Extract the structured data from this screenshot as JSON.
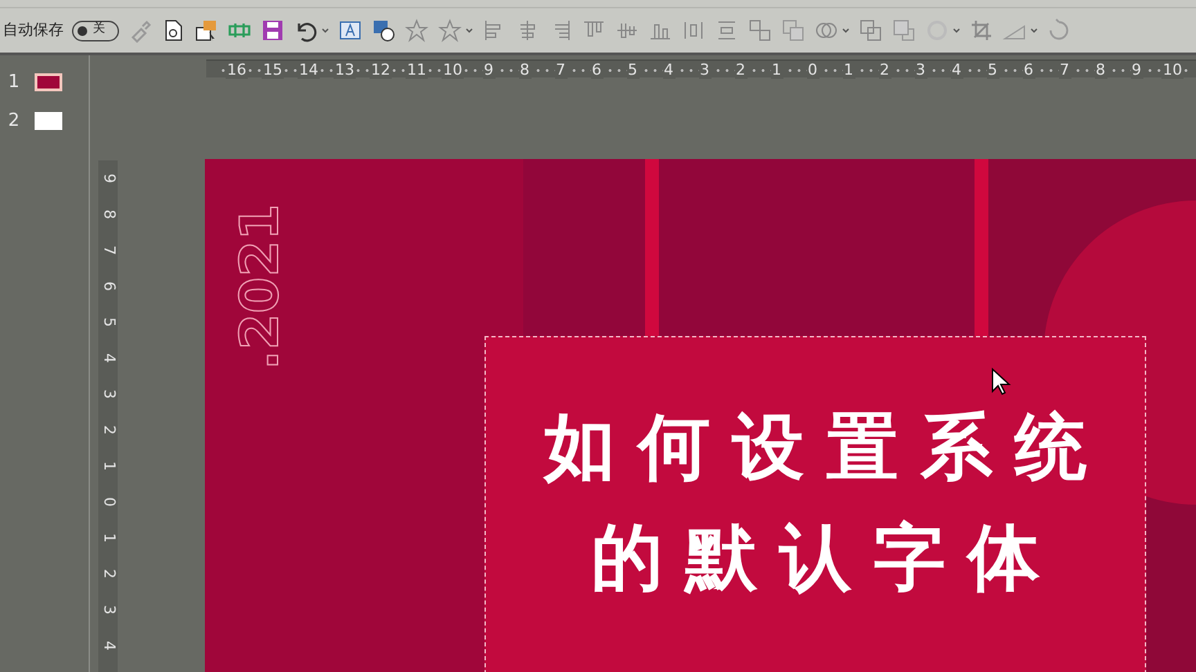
{
  "toolbar": {
    "autosave_label": "自动保存",
    "autosave_toggle": {
      "on": false,
      "label": "关"
    }
  },
  "slides": [
    {
      "number": "1",
      "kind": "title",
      "selected": true
    },
    {
      "number": "2",
      "kind": "blank",
      "selected": false
    }
  ],
  "horizontal_ruler": {
    "labels": [
      "16",
      "15",
      "14",
      "13",
      "12",
      "11",
      "10",
      "9",
      "8",
      "7",
      "6",
      "5",
      "4",
      "3",
      "2",
      "1",
      "0",
      "1",
      "2",
      "3",
      "4",
      "5",
      "6",
      "7",
      "8",
      "9",
      "10"
    ]
  },
  "vertical_ruler": {
    "labels": [
      "9",
      "8",
      "7",
      "6",
      "5",
      "4",
      "3",
      "2",
      "1",
      "0",
      "1",
      "2",
      "3",
      "4"
    ]
  },
  "slide": {
    "year": ".2021",
    "title_lines": [
      "如何设置系统",
      "的默认字体"
    ]
  }
}
